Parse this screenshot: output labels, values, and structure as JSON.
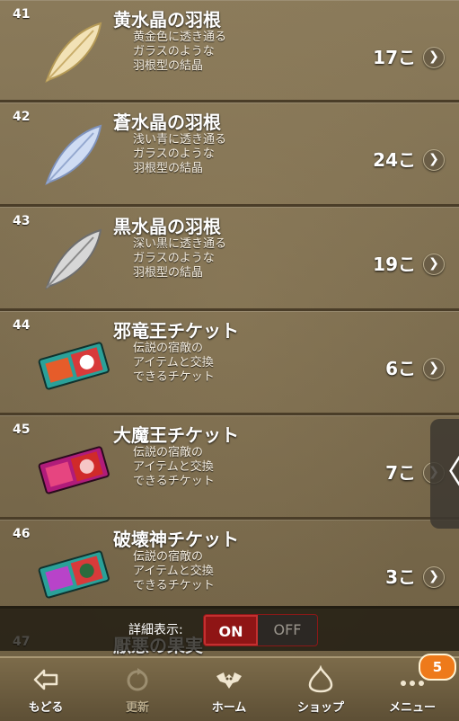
{
  "items": [
    {
      "num": "41",
      "title": "黄水晶の羽根",
      "desc": [
        "黄金色に透き通る",
        "ガラスのような",
        "羽根型の結晶"
      ],
      "count": "17こ",
      "icon": "yellow-crystal-feather-icon",
      "color": "#f2e2b6"
    },
    {
      "num": "42",
      "title": "蒼水晶の羽根",
      "desc": [
        "浅い青に透き通る",
        "ガラスのような",
        "羽根型の結晶"
      ],
      "count": "24こ",
      "icon": "blue-crystal-feather-icon",
      "color": "#cfdcf3"
    },
    {
      "num": "43",
      "title": "黒水晶の羽根",
      "desc": [
        "深い黒に透き通る",
        "ガラスのような",
        "羽根型の結晶"
      ],
      "count": "19こ",
      "icon": "black-crystal-feather-icon",
      "color": "#d7d7d7"
    },
    {
      "num": "44",
      "title": "邪竜王チケット",
      "desc": [
        "伝説の宿敵の",
        "アイテムと交換",
        "できるチケット"
      ],
      "count": "6こ",
      "icon": "ticket-icon",
      "color": "#2aa199"
    },
    {
      "num": "45",
      "title": "大魔王チケット",
      "desc": [
        "伝説の宿敵の",
        "アイテムと交換",
        "できるチケット"
      ],
      "count": "7こ",
      "icon": "ticket-icon",
      "color": "#b01c7a"
    },
    {
      "num": "46",
      "title": "破壊神チケット",
      "desc": [
        "伝説の宿敵の",
        "アイテムと交換",
        "できるチケット"
      ],
      "count": "3こ",
      "icon": "ticket-icon",
      "color": "#2aa199"
    }
  ],
  "peek": {
    "num": "47",
    "title": "厭悪の果実"
  },
  "detail": {
    "label": "詳細表示:",
    "on": "ON",
    "off": "OFF"
  },
  "side_tab": {
    "glyph": "〈"
  },
  "nav": {
    "back": "もどる",
    "update": "更新",
    "home": "ホーム",
    "shop": "ショップ",
    "menu": "メニュー",
    "menu_badge": "5"
  }
}
